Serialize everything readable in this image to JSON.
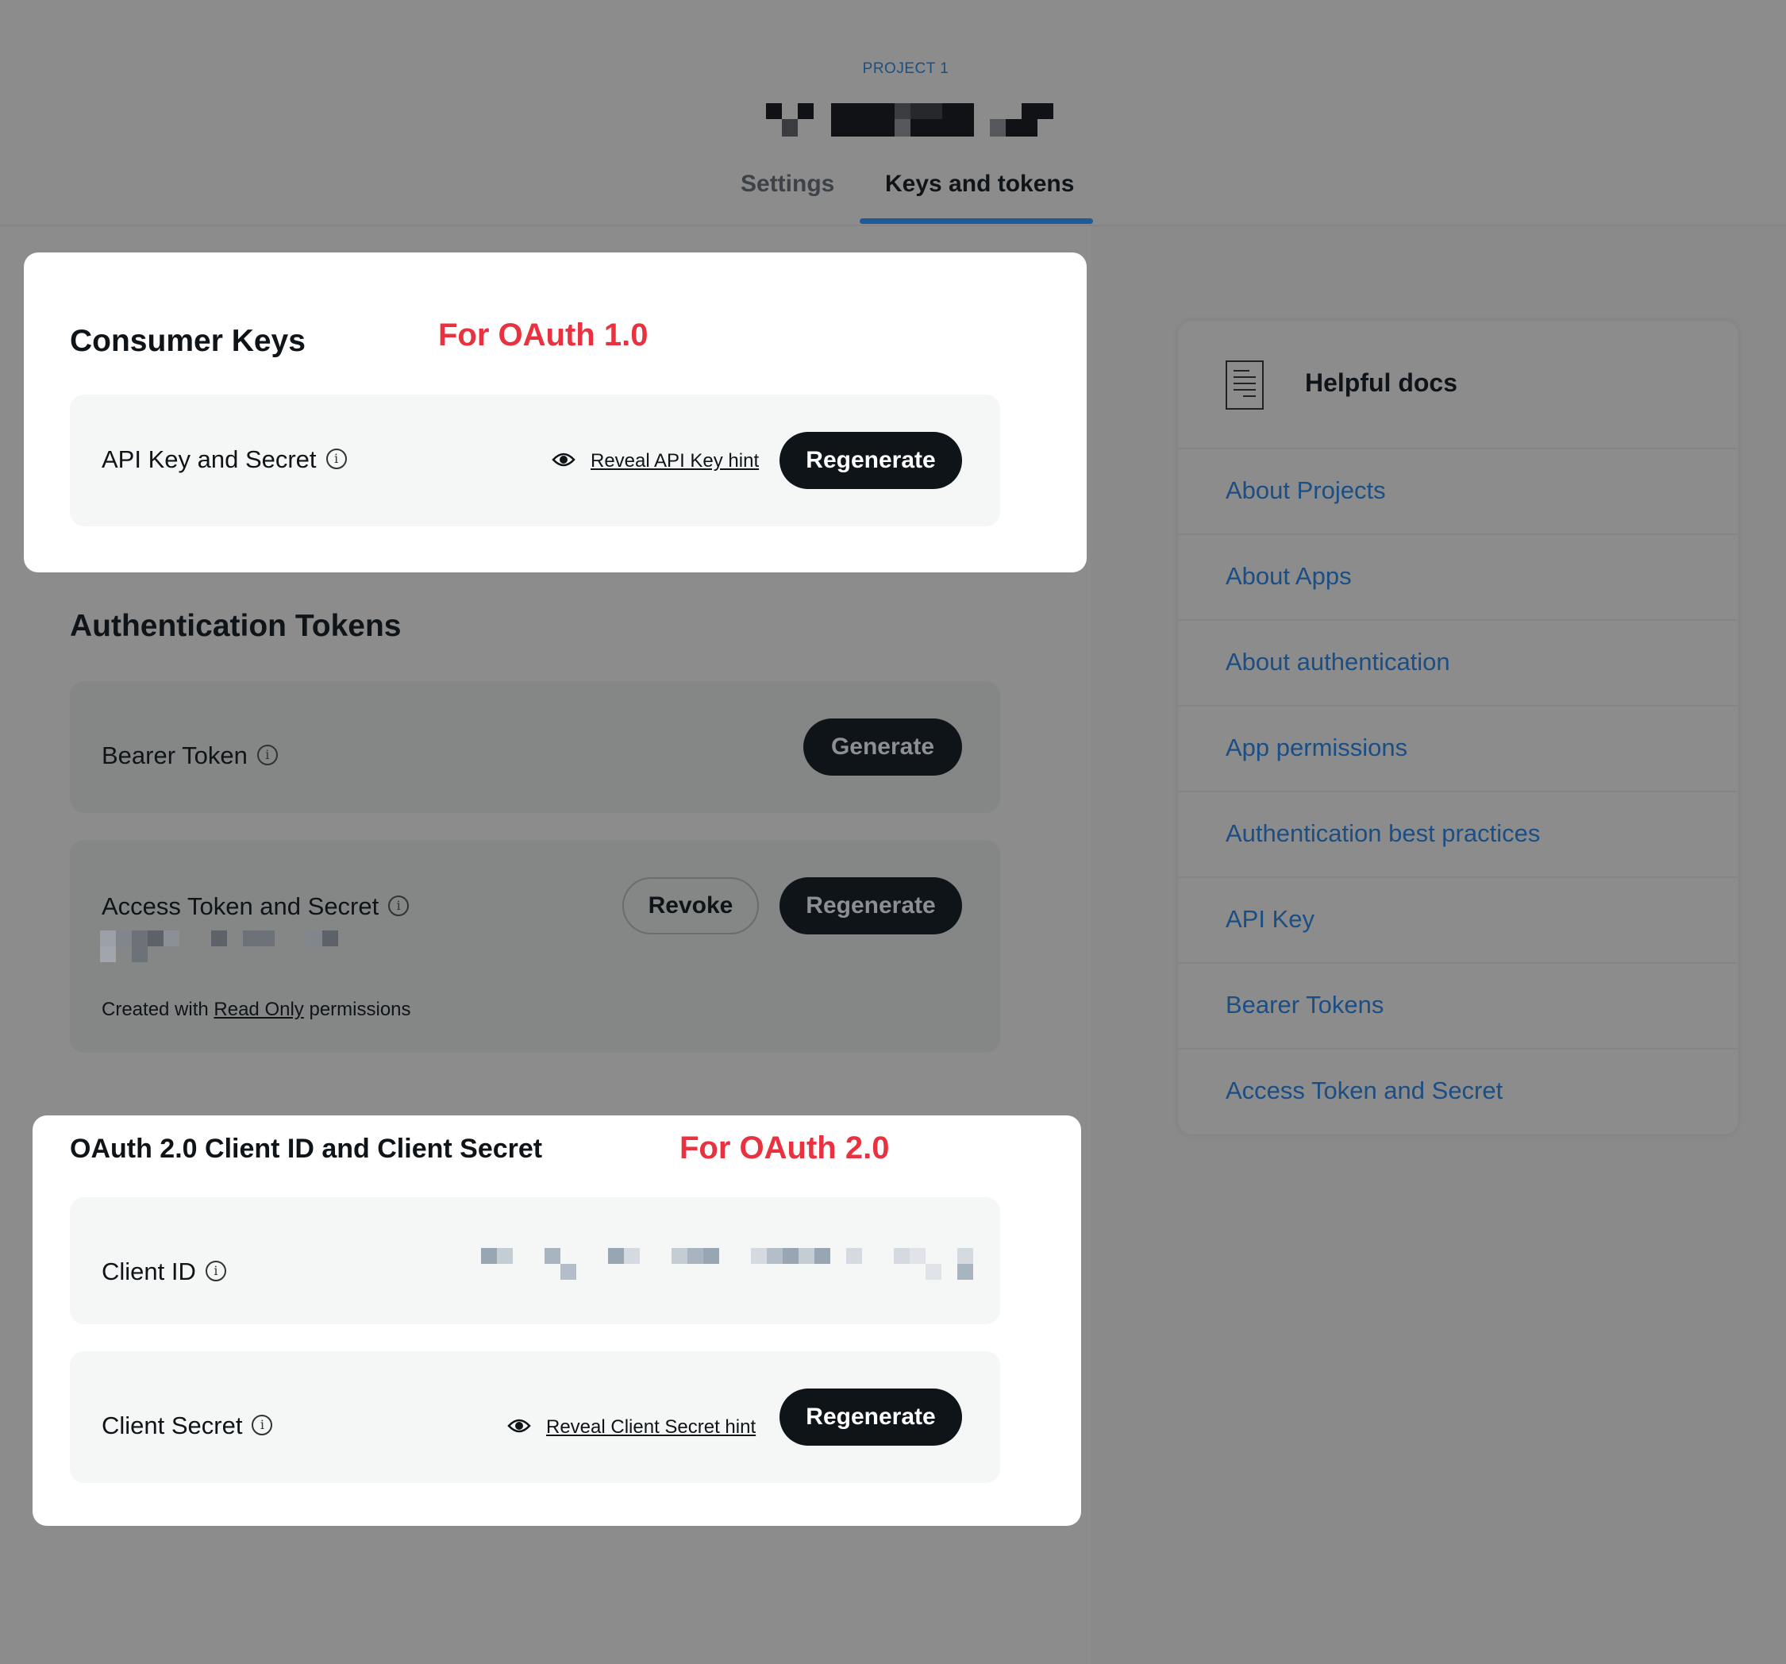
{
  "header": {
    "project_label": "PROJECT 1",
    "tabs": [
      {
        "label": "Settings"
      },
      {
        "label": "Keys and tokens"
      }
    ]
  },
  "consumer_keys": {
    "title": "Consumer Keys",
    "annotation": "For OAuth 1.0",
    "api_key_label": "API Key and Secret",
    "reveal_label": "Reveal API Key hint",
    "regenerate_label": "Regenerate"
  },
  "auth_tokens": {
    "title": "Authentication Tokens",
    "bearer_label": "Bearer Token",
    "generate_label": "Generate",
    "access_label": "Access Token and Secret",
    "revoke_label": "Revoke",
    "regenerate_label": "Regenerate",
    "created_prefix": "Created with",
    "created_link": "Read Only",
    "created_suffix": "permissions"
  },
  "oauth2": {
    "title": "OAuth 2.0 Client ID and Client Secret",
    "annotation": "For OAuth 2.0",
    "client_id_label": "Client ID",
    "client_secret_label": "Client Secret",
    "reveal_label": "Reveal Client Secret hint",
    "regenerate_label": "Regenerate"
  },
  "docs": {
    "title": "Helpful docs",
    "links": [
      "About Projects",
      "About Apps",
      "About authentication",
      "App permissions",
      "Authentication best practices",
      "API Key",
      "Bearer Tokens",
      "Access Token and Secret"
    ]
  },
  "colors": {
    "accent_link": "#1b4e84",
    "annotation_red": "#e8323f",
    "button_black": "#0f1419"
  }
}
